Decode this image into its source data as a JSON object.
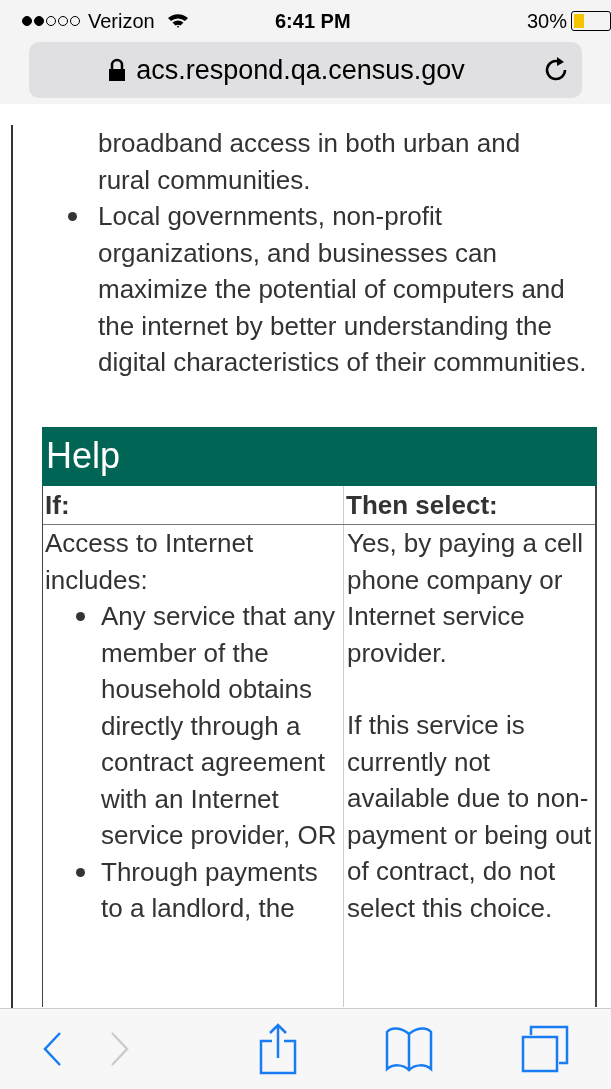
{
  "status_bar": {
    "carrier": "Verizon",
    "time": "6:41 PM",
    "battery": "30%"
  },
  "address_bar": {
    "url": "acs.respond.qa.census.gov",
    "secure": true
  },
  "intro_list": [
    {
      "text": "broadband access in both urban and rural communities.",
      "bullet": false
    },
    {
      "text": "Local governments, non-profit organizations, and businesses can maximize the potential of computers and the internet by better understanding the digital characteristics of their communities.",
      "bullet": true
    }
  ],
  "help": {
    "title": "Help",
    "columns": [
      "If:",
      "Then select:"
    ],
    "rows": [
      {
        "if_text": "Access to Internet includes:",
        "if_items": [
          "Any service that any member of the household obtains directly through a contract agreement with an Internet service provider, OR",
          "Through payments to a landlord, the"
        ],
        "then_paragraphs": [
          "Yes, by paying a cell phone company or Internet service provider.",
          "If this service is currently not available due to non-payment or being out of contract, do not select this choice."
        ]
      }
    ]
  },
  "toolbar": {
    "back_enabled": true,
    "forward_enabled": false
  }
}
